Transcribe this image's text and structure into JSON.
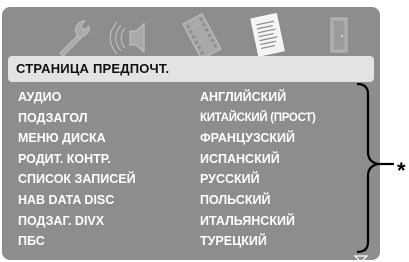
{
  "tabs": [
    {
      "icon": "wrench-icon",
      "name": "general-setup"
    },
    {
      "icon": "speaker-icon",
      "name": "audio-setup"
    },
    {
      "icon": "film-icon",
      "name": "video-setup"
    },
    {
      "icon": "document-icon",
      "name": "preference",
      "active": true
    },
    {
      "icon": "door-icon",
      "name": "exit"
    }
  ],
  "header": {
    "title": "СТРАНИЦА ПРЕДПОЧТ."
  },
  "menu": {
    "items": [
      {
        "label": "АУДИО",
        "selected": true
      },
      {
        "label": "ПОДЗАГОЛ"
      },
      {
        "label": "МЕНЮ ДИСКА"
      },
      {
        "label": "РОДИТ. КОНТР."
      },
      {
        "label": "СПИСОК ЗАПИСЕЙ"
      },
      {
        "label": "HAB DATA DISC"
      },
      {
        "label": "ПОДЗАГ. DIVX"
      },
      {
        "label": "ПБС"
      }
    ]
  },
  "options": {
    "items": [
      {
        "label": "АНГЛИЙСКИЙ"
      },
      {
        "label": "КИТАЙСКИЙ (ПРОСТ)"
      },
      {
        "label": "ФРАНЦУЗСКИЙ"
      },
      {
        "label": "ИСПАНСКИЙ"
      },
      {
        "label": "РУССКИЙ"
      },
      {
        "label": "ПОЛЬСКИЙ"
      },
      {
        "label": "ИТАЛЬЯНСКИЙ"
      },
      {
        "label": "ТУРЕЦКИЙ"
      }
    ]
  },
  "annotation": {
    "marker": "*"
  },
  "colors": {
    "panel": "#8d8d8d",
    "header_bar": "#e3e3e3",
    "text": "#ffffff"
  }
}
